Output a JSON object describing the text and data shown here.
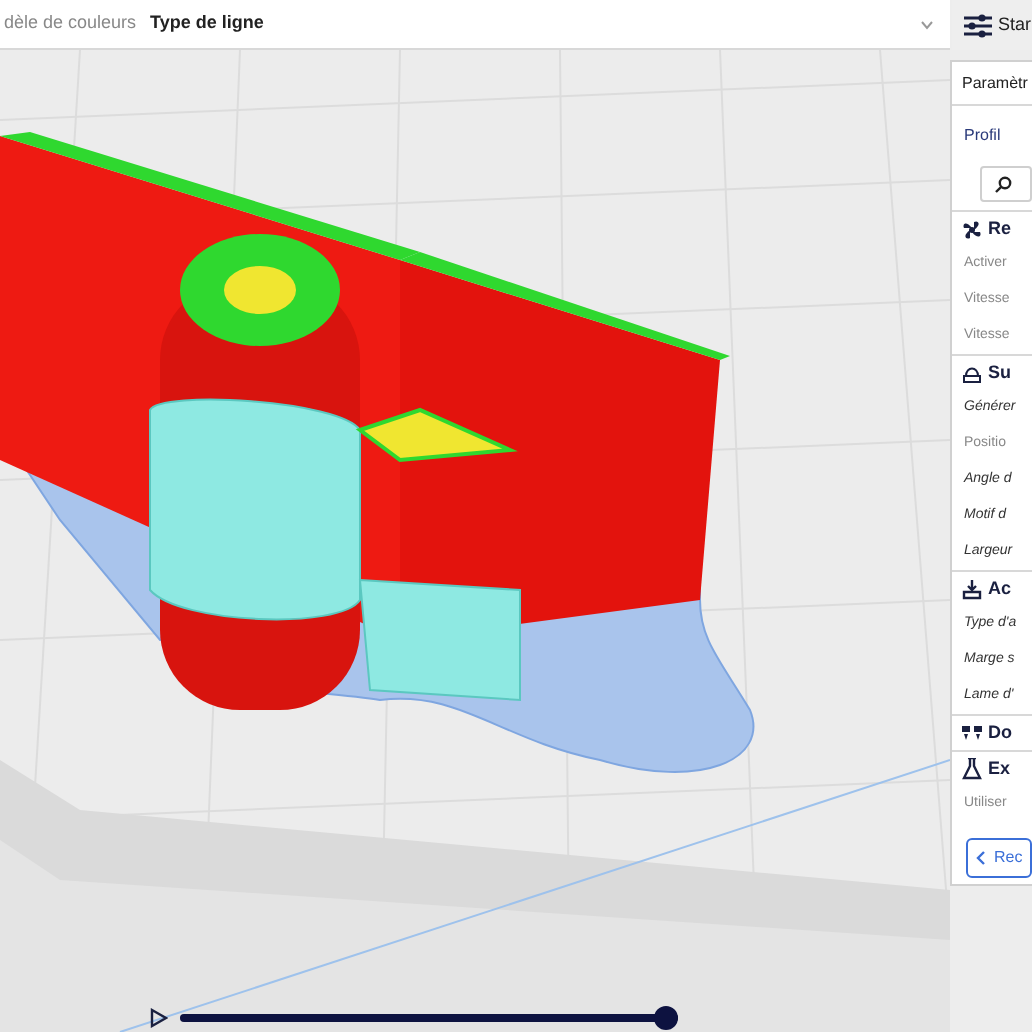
{
  "toolbar": {
    "color_scheme_label": "dèle de couleurs",
    "color_scheme_value": "Type de ligne"
  },
  "settings_tab": {
    "label": "Star"
  },
  "panel": {
    "title": "Paramètr",
    "profile_label": "Profil",
    "items": [
      {
        "kind": "section",
        "label": "Re"
      },
      {
        "kind": "setting",
        "label": "Activer",
        "modified": false
      },
      {
        "kind": "setting",
        "label": "Vitesse",
        "modified": false
      },
      {
        "kind": "setting",
        "label": "Vitesse",
        "modified": false
      },
      {
        "kind": "section",
        "label": "Su"
      },
      {
        "kind": "setting",
        "label": "Générer",
        "modified": true
      },
      {
        "kind": "setting",
        "label": "Positio",
        "modified": false
      },
      {
        "kind": "setting",
        "label": "Angle d",
        "modified": true
      },
      {
        "kind": "setting",
        "label": "Motif d",
        "modified": true
      },
      {
        "kind": "setting",
        "label": "Largeur",
        "modified": true
      },
      {
        "kind": "section",
        "label": "Ac"
      },
      {
        "kind": "setting",
        "label": "Type d'a",
        "modified": true
      },
      {
        "kind": "setting",
        "label": "Marge s",
        "modified": true
      },
      {
        "kind": "setting",
        "label": "Lame d'",
        "modified": true
      },
      {
        "kind": "section",
        "label": "Do"
      },
      {
        "kind": "section",
        "label": "Ex"
      },
      {
        "kind": "setting",
        "label": "Utiliser",
        "modified": false
      }
    ],
    "button": "Rec"
  },
  "layer_slider": {
    "level": 1.0
  }
}
